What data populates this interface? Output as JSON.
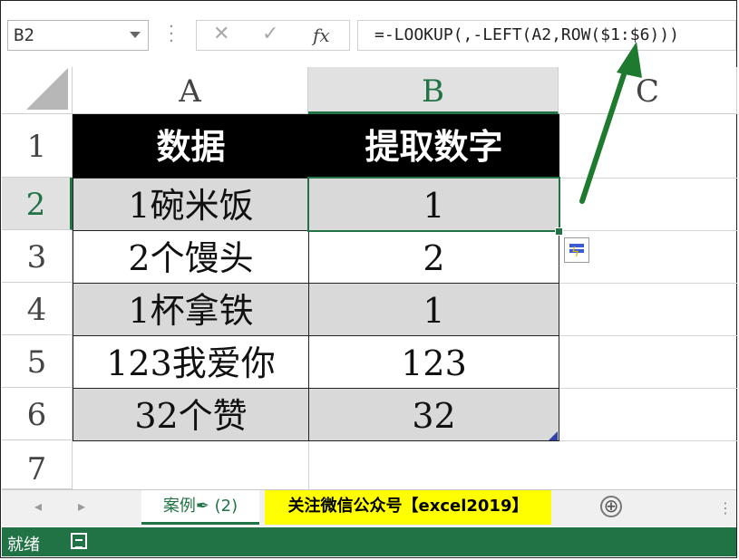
{
  "namebox": {
    "value": "B2"
  },
  "formula_bar": {
    "cancel_icon": "✕",
    "enter_icon": "✓",
    "fx_label": "fx",
    "formula": "=-LOOKUP(,-LEFT(A2,ROW($1:$6)))"
  },
  "columns": [
    "A",
    "B",
    "C"
  ],
  "rows": [
    "1",
    "2",
    "3",
    "4",
    "5",
    "6",
    "7"
  ],
  "table": {
    "header": [
      "数据",
      "提取数字"
    ],
    "data": [
      [
        "1碗米饭",
        "1"
      ],
      [
        "2个馒头",
        "2"
      ],
      [
        "1杯拿铁",
        "1"
      ],
      [
        "123我爱你",
        "123"
      ],
      [
        "32个赞",
        "32"
      ]
    ]
  },
  "sheet_tabs": {
    "tab1": "案例✒ (2)",
    "tab2": "关注微信公众号【excel2019】",
    "add_icon": "⊕"
  },
  "status": {
    "ready": "就绪"
  },
  "colors": {
    "excel_green": "#217346",
    "arrow_green": "#1e7a2e",
    "tab_highlight": "#ffff00"
  }
}
